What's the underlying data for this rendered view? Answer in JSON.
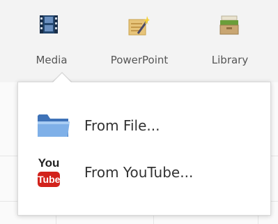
{
  "toolbar": {
    "items": [
      {
        "label": "Media",
        "icon": "film-strip-icon"
      },
      {
        "label": "PowerPoint",
        "icon": "powerpoint-wand-icon"
      },
      {
        "label": "Library",
        "icon": "library-box-icon"
      }
    ]
  },
  "media_menu": {
    "items": [
      {
        "label": "From File...",
        "icon": "folder-icon"
      },
      {
        "label": "From YouTube...",
        "icon": "youtube-icon"
      }
    ]
  },
  "youtube_icon": {
    "you": "You",
    "tube": "Tube"
  },
  "colors": {
    "toolbar_bg": "#f3f3f3",
    "text": "#333333",
    "label": "#555555",
    "folder": "#5b8fd3",
    "youtube_red": "#d2221b"
  }
}
